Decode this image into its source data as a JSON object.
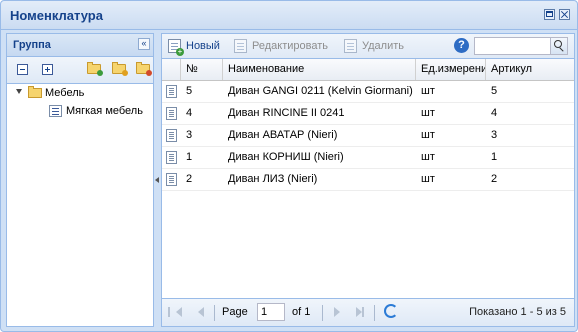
{
  "window": {
    "title": "Номенклатура"
  },
  "left_panel": {
    "title": "Группа",
    "tree": [
      {
        "label": "Мебель",
        "expanded": true,
        "children": [
          {
            "label": "Мягкая мебель"
          }
        ]
      }
    ]
  },
  "toolbar": {
    "new_label": "Новый",
    "edit_label": "Редактировать",
    "delete_label": "Удалить",
    "search_placeholder": ""
  },
  "grid": {
    "columns": [
      "№",
      "Наименование",
      "Ед.измерения",
      "Артикул"
    ],
    "rows": [
      {
        "num": "5",
        "name": "Диван GANGI 0211 (Kelvin Giormani)",
        "unit": "шт",
        "article": "5"
      },
      {
        "num": "4",
        "name": "Диван RINCINE II 0241",
        "unit": "шт",
        "article": "4"
      },
      {
        "num": "3",
        "name": "Диван АВАТАР (Nieri)",
        "unit": "шт",
        "article": "3"
      },
      {
        "num": "1",
        "name": "Диван КОРНИШ (Nieri)",
        "unit": "шт",
        "article": "1"
      },
      {
        "num": "2",
        "name": "Диван ЛИЗ (Nieri)",
        "unit": "шт",
        "article": "2"
      }
    ]
  },
  "pager": {
    "page_label": "Page",
    "page_value": "1",
    "of_label": "of 1",
    "info": "Показано 1 - 5 из 5"
  }
}
